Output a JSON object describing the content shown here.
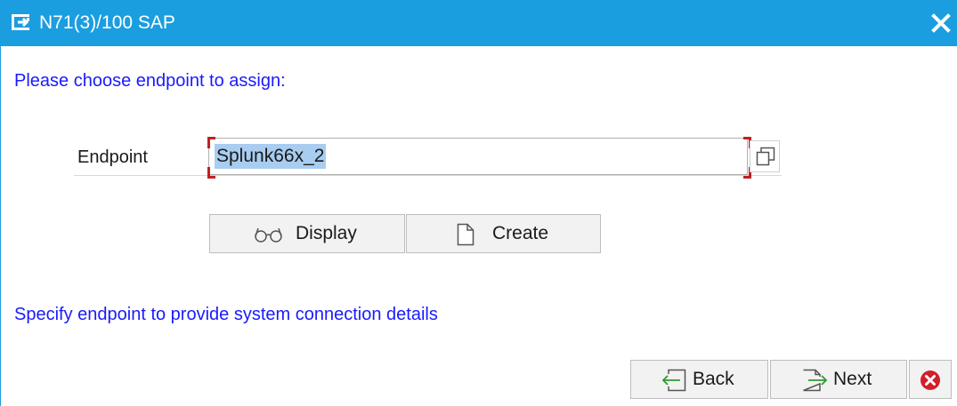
{
  "window": {
    "title": "N71(3)/100 SAP",
    "title_icon": "dialog-window-icon",
    "close_icon": "close-icon"
  },
  "content": {
    "instruction": "Please choose endpoint to assign:",
    "endpoint_label": "Endpoint",
    "endpoint_value": "Splunk66x_2",
    "value_help_icon": "value-help-icon",
    "hint": "Specify endpoint to provide system connection details"
  },
  "actions": {
    "display_label": "Display",
    "display_icon": "glasses-icon",
    "create_label": "Create",
    "create_icon": "new-document-icon"
  },
  "footer": {
    "back_label": "Back",
    "back_icon": "back-arrow-icon",
    "next_label": "Next",
    "next_icon": "next-arrow-icon",
    "cancel_icon": "cancel-icon"
  },
  "colors": {
    "titlebar": "#1a9ee0",
    "instruction_text": "#1a1aff",
    "selection_highlight": "#a8cdf0",
    "required_marker": "#c02020",
    "cancel": "#d0202a",
    "arrow": "#2f9a2f"
  }
}
